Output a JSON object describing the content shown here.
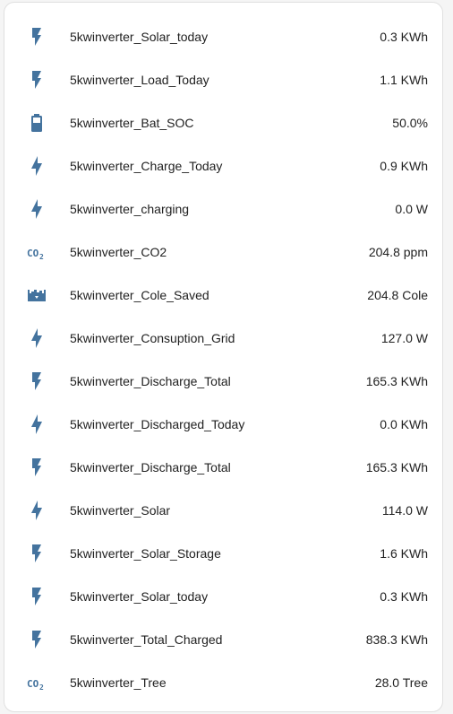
{
  "theme": {
    "icon_color": "#44739e"
  },
  "entities": [
    {
      "icon": "flash-icon",
      "name": "5kwinverter_Solar_today",
      "value": "0.3 KWh"
    },
    {
      "icon": "flash-icon",
      "name": "5kwinverter_Load_Today",
      "value": "1.1 KWh"
    },
    {
      "icon": "battery-icon",
      "name": "5kwinverter_Bat_SOC",
      "value": "50.0%"
    },
    {
      "icon": "lightning-bolt-icon",
      "name": "5kwinverter_Charge_Today",
      "value": "0.9 KWh"
    },
    {
      "icon": "lightning-bolt-icon",
      "name": "5kwinverter_charging",
      "value": "0.0 W"
    },
    {
      "icon": "co2-icon",
      "name": "5kwinverter_CO2",
      "value": "204.8 ppm"
    },
    {
      "icon": "coal-cart-icon",
      "name": "5kwinverter_Cole_Saved",
      "value": "204.8 Cole"
    },
    {
      "icon": "lightning-bolt-icon",
      "name": "5kwinverter_Consuption_Grid",
      "value": "127.0 W"
    },
    {
      "icon": "flash-icon",
      "name": "5kwinverter_Discharge_Total",
      "value": "165.3 KWh"
    },
    {
      "icon": "lightning-bolt-icon",
      "name": "5kwinverter_Discharged_Today",
      "value": "0.0 KWh"
    },
    {
      "icon": "flash-icon",
      "name": "5kwinverter_Discharge_Total",
      "value": "165.3 KWh"
    },
    {
      "icon": "lightning-bolt-icon",
      "name": "5kwinverter_Solar",
      "value": "114.0 W"
    },
    {
      "icon": "flash-icon",
      "name": "5kwinverter_Solar_Storage",
      "value": "1.6 KWh"
    },
    {
      "icon": "flash-icon",
      "name": "5kwinverter_Solar_today",
      "value": "0.3 KWh"
    },
    {
      "icon": "flash-icon",
      "name": "5kwinverter_Total_Charged",
      "value": "838.3 KWh"
    },
    {
      "icon": "co2-icon",
      "name": "5kwinverter_Tree",
      "value": "28.0 Tree"
    }
  ]
}
